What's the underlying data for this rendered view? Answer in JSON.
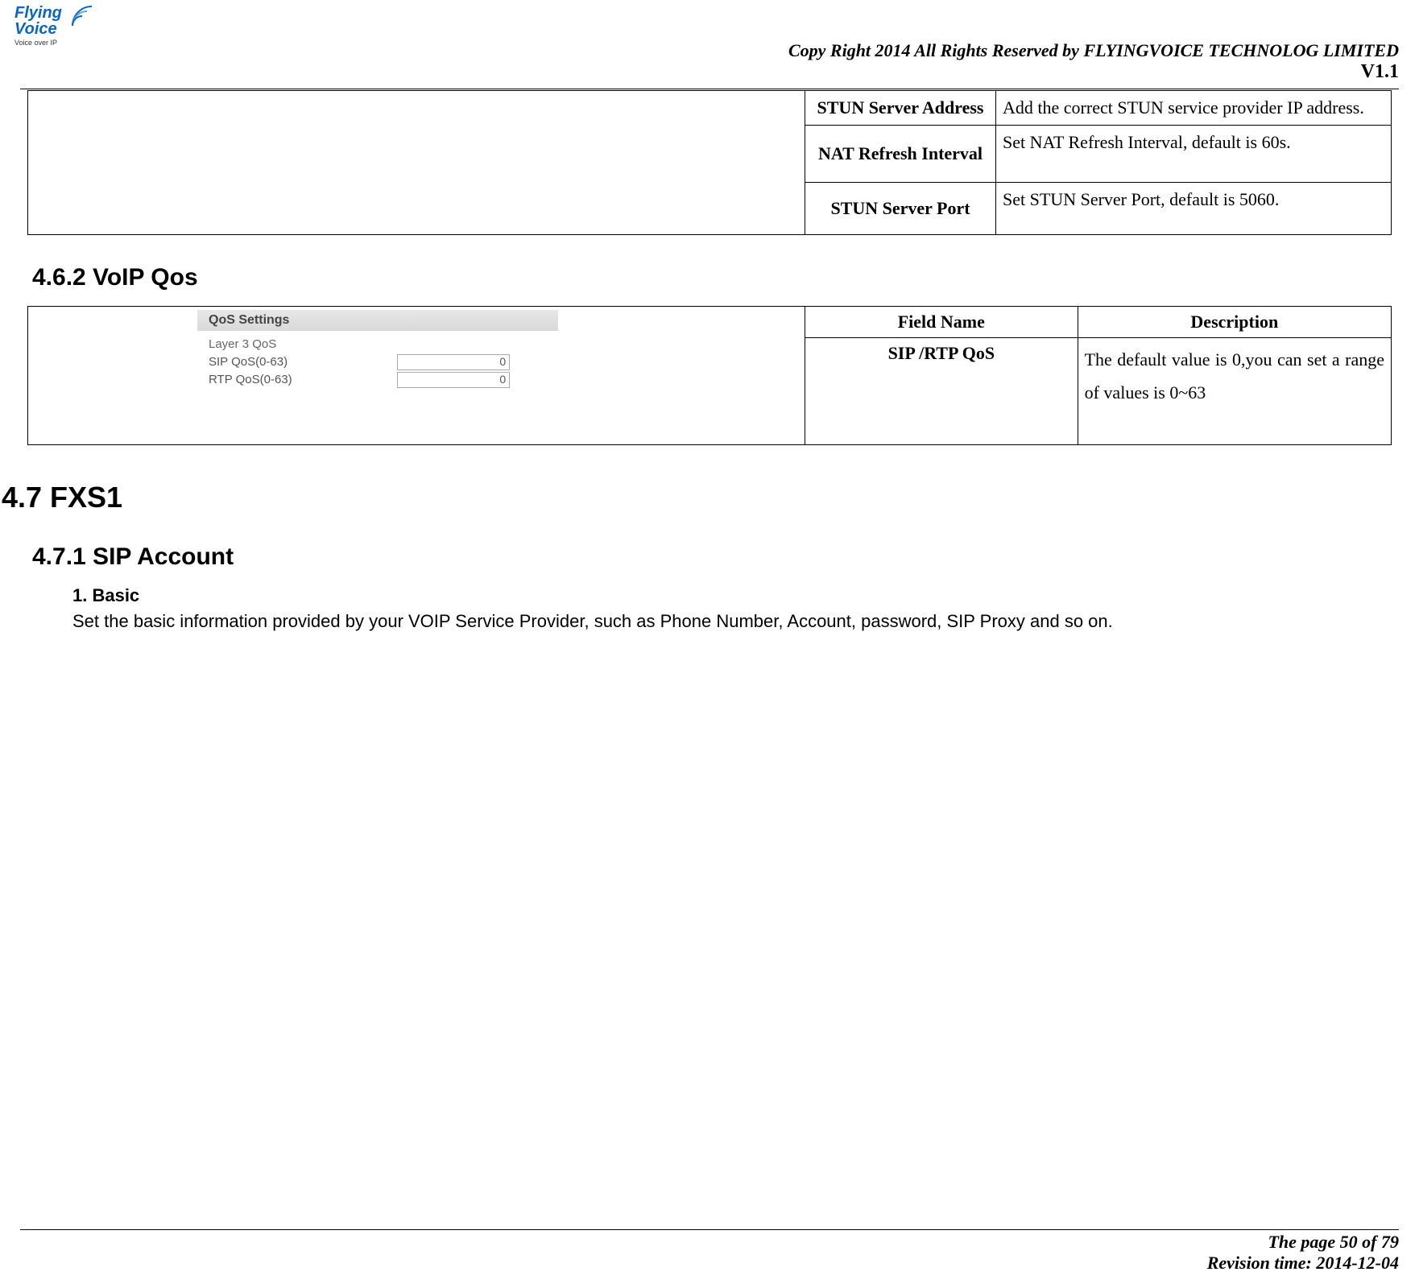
{
  "logo": {
    "line1a": "Flying",
    "line2": "Voice",
    "tag": "Voice over IP"
  },
  "header": {
    "copyright": "Copy Right 2014 All Rights Reserved by FLYINGVOICE TECHNOLOG LIMITED",
    "version": "V1.1"
  },
  "table_top": {
    "rows": [
      {
        "field": "STUN Server Address",
        "desc": "Add the correct STUN service provider IP address."
      },
      {
        "field": "NAT Refresh Interval",
        "desc": "Set NAT Refresh Interval, default is 60s."
      },
      {
        "field": "STUN Server Port",
        "desc": "Set STUN Server Port, default is 5060."
      }
    ]
  },
  "headings": {
    "h462": "4.6.2 VoIP Qos",
    "h47": "4.7  FXS1",
    "h471": "4.7.1 SIP Account",
    "basic_num": "1.  Basic",
    "basic_text": "Set the basic information provided by your VOIP Service Provider, such as Phone Number, Account, password, SIP Proxy and so on."
  },
  "qos_panel": {
    "title": "QoS Settings",
    "subtitle": "Layer 3 QoS",
    "sip_label": "SIP QoS(0-63)",
    "sip_value": "0",
    "rtp_label": "RTP QoS(0-63)",
    "rtp_value": "0"
  },
  "table_qos": {
    "header_field": "Field Name",
    "header_desc": "Description",
    "row_field": "SIP /RTP QoS",
    "row_desc": "The default value is 0,you can set a range of values is 0~63"
  },
  "footer": {
    "page": "The page 50 of 79",
    "revision": "Revision time: 2014-12-04"
  }
}
